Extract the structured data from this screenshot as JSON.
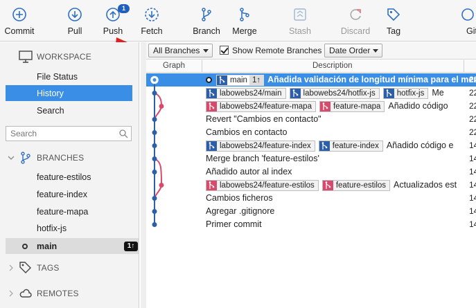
{
  "toolbar": {
    "commit": "Commit",
    "pull": "Pull",
    "push": "Push",
    "push_badge": "1",
    "fetch": "Fetch",
    "branch": "Branch",
    "merge": "Merge",
    "stash": "Stash",
    "discard": "Discard",
    "tag": "Tag",
    "git_flow": "Git",
    "accent_color": "#1f5fbf",
    "arrow_color": "#e02020"
  },
  "sidebar": {
    "workspace": {
      "label": "WORKSPACE",
      "items": [
        "File Status",
        "History",
        "Search"
      ],
      "selected": "History"
    },
    "search_placeholder": "Search",
    "branches": {
      "label": "BRANCHES",
      "items": [
        "feature-estilos",
        "feature-index",
        "feature-mapa",
        "hotfix-js",
        "main"
      ],
      "current": "main",
      "current_ahead": "1↑"
    },
    "tags_label": "TAGS",
    "remotes_label": "REMOTES"
  },
  "filters": {
    "branches_select": "All Branches",
    "show_remote_label": "Show Remote Branches",
    "show_remote_checked": true,
    "order_select": "Date Order"
  },
  "columns": {
    "graph": "Graph",
    "description": "Description"
  },
  "commits": [
    {
      "tags": [
        {
          "name": "main",
          "color": "main",
          "count": "1↑"
        }
      ],
      "message": "Añadida validación de longitud mínima para el mensaje",
      "date": "22",
      "head": true,
      "selected": true
    },
    {
      "tags": [
        {
          "name": "labowebs24/main",
          "color": "blue"
        },
        {
          "name": "labowebs24/hotfix-js",
          "color": "blue"
        },
        {
          "name": "hotfix-js",
          "color": "blue"
        }
      ],
      "message": "Me",
      "date": "22"
    },
    {
      "tags": [
        {
          "name": "labowebs24/feature-mapa",
          "color": "pink"
        },
        {
          "name": "feature-mapa",
          "color": "pink"
        }
      ],
      "message": "Añadido código",
      "date": "22"
    },
    {
      "tags": [],
      "message": "Revert \"Cambios en contacto\"",
      "date": "22"
    },
    {
      "tags": [],
      "message": "Cambios en contacto",
      "date": "22"
    },
    {
      "tags": [
        {
          "name": "labowebs24/feature-index",
          "color": "blue"
        },
        {
          "name": "feature-index",
          "color": "blue"
        }
      ],
      "message": "Añadido código e",
      "date": "14"
    },
    {
      "tags": [],
      "message": "Merge branch 'feature-estilos'",
      "date": "14"
    },
    {
      "tags": [],
      "message": "Añadido autor al index",
      "date": "14"
    },
    {
      "tags": [
        {
          "name": "labowebs24/feature-estilos",
          "color": "pink"
        },
        {
          "name": "feature-estilos",
          "color": "pink"
        }
      ],
      "message": "Actualizados est",
      "date": "14"
    },
    {
      "tags": [],
      "message": "Cambios ficheros",
      "date": "14"
    },
    {
      "tags": [],
      "message": "Agregar .gitignore",
      "date": "14"
    },
    {
      "tags": [],
      "message": "Primer commit",
      "date": "14"
    }
  ],
  "graph_colors": {
    "mainline": "#2c5fa8",
    "side": "#d84a6b"
  }
}
